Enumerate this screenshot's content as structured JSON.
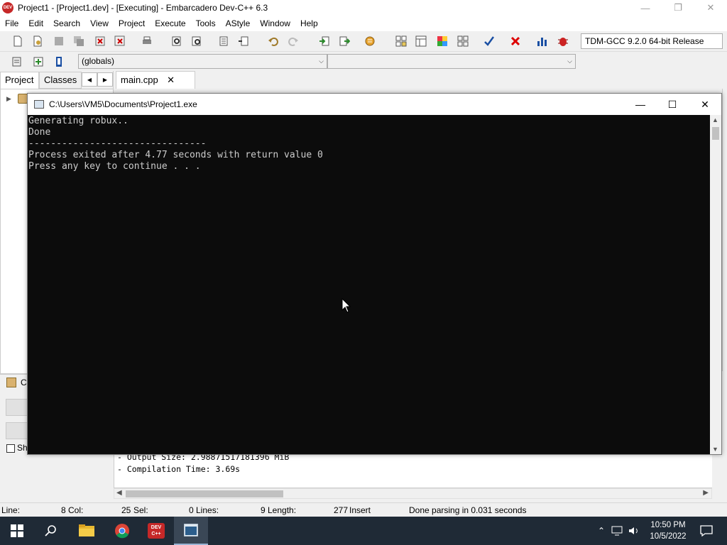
{
  "window": {
    "title": "Project1 - [Project1.dev] - [Executing] - Embarcadero Dev-C++ 6.3",
    "logo_text": "DEV"
  },
  "menu": [
    "File",
    "Edit",
    "Search",
    "View",
    "Project",
    "Execute",
    "Tools",
    "AStyle",
    "Window",
    "Help"
  ],
  "toolbar": {
    "compiler": "TDM-GCC 9.2.0 64-bit Release",
    "scope_combo": "(globals)",
    "member_combo": ""
  },
  "left_panel": {
    "tabs": [
      "Project",
      "Classes"
    ],
    "active_tab": "Project",
    "bottom_label": "C",
    "checkbox_label": "Sh"
  },
  "editor": {
    "tab_label": "main.cpp",
    "close_glyph": "✕"
  },
  "console": {
    "title": "C:\\Users\\VM5\\Documents\\Project1.exe",
    "lines": [
      "Generating robux..",
      "Done",
      "--------------------------------",
      "Process exited after 4.77 seconds with return value 0",
      "Press any key to continue . . ."
    ]
  },
  "compile_log": {
    "lines": [
      "- Output Size: 2.98871517181396 MiB",
      "- Compilation Time: 3.69s"
    ]
  },
  "status": {
    "line_label": "Line:",
    "line_value": "8",
    "col_label": "Col:",
    "col_value": "25",
    "sel_label": "Sel:",
    "sel_value": "0",
    "lines_label": "Lines:",
    "lines_value": "9",
    "length_label": "Length:",
    "length_value": "277",
    "mode": "Insert",
    "message": "Done parsing in 0.031 seconds"
  },
  "taskbar": {
    "time": "10:50 PM",
    "date": "10/5/2022",
    "devcpp_badge": "DEV C++"
  }
}
